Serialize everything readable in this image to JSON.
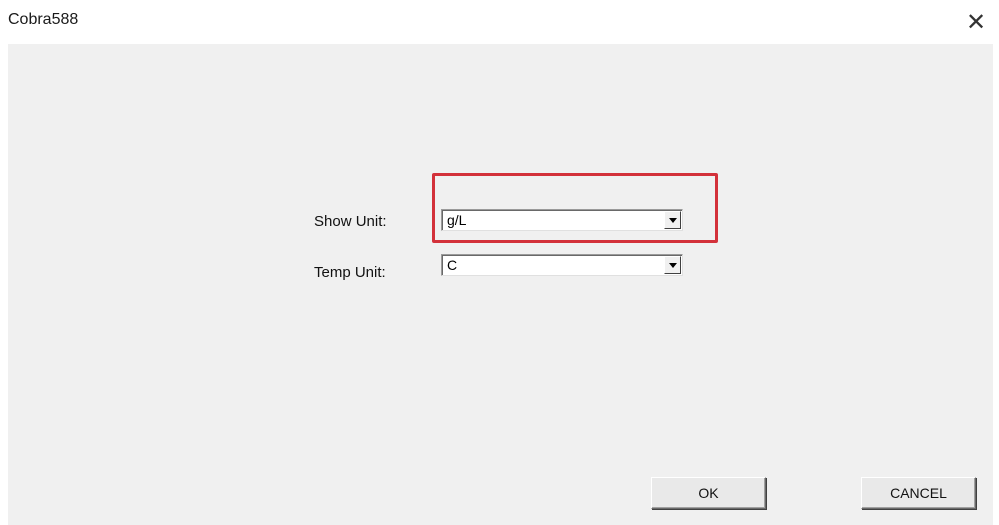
{
  "window": {
    "title": "Cobra588",
    "close_glyph": "✕"
  },
  "form": {
    "show_unit": {
      "label": "Show Unit:",
      "value": "g/L"
    },
    "temp_unit": {
      "label": "Temp Unit:",
      "value": "C"
    }
  },
  "buttons": {
    "ok": "OK",
    "cancel": "CANCEL"
  },
  "colors": {
    "highlight": "#d3313a",
    "dialog_bg": "#f0f0f0"
  },
  "icons": {
    "close": "close-icon",
    "dropdown": "chevron-down-icon"
  }
}
